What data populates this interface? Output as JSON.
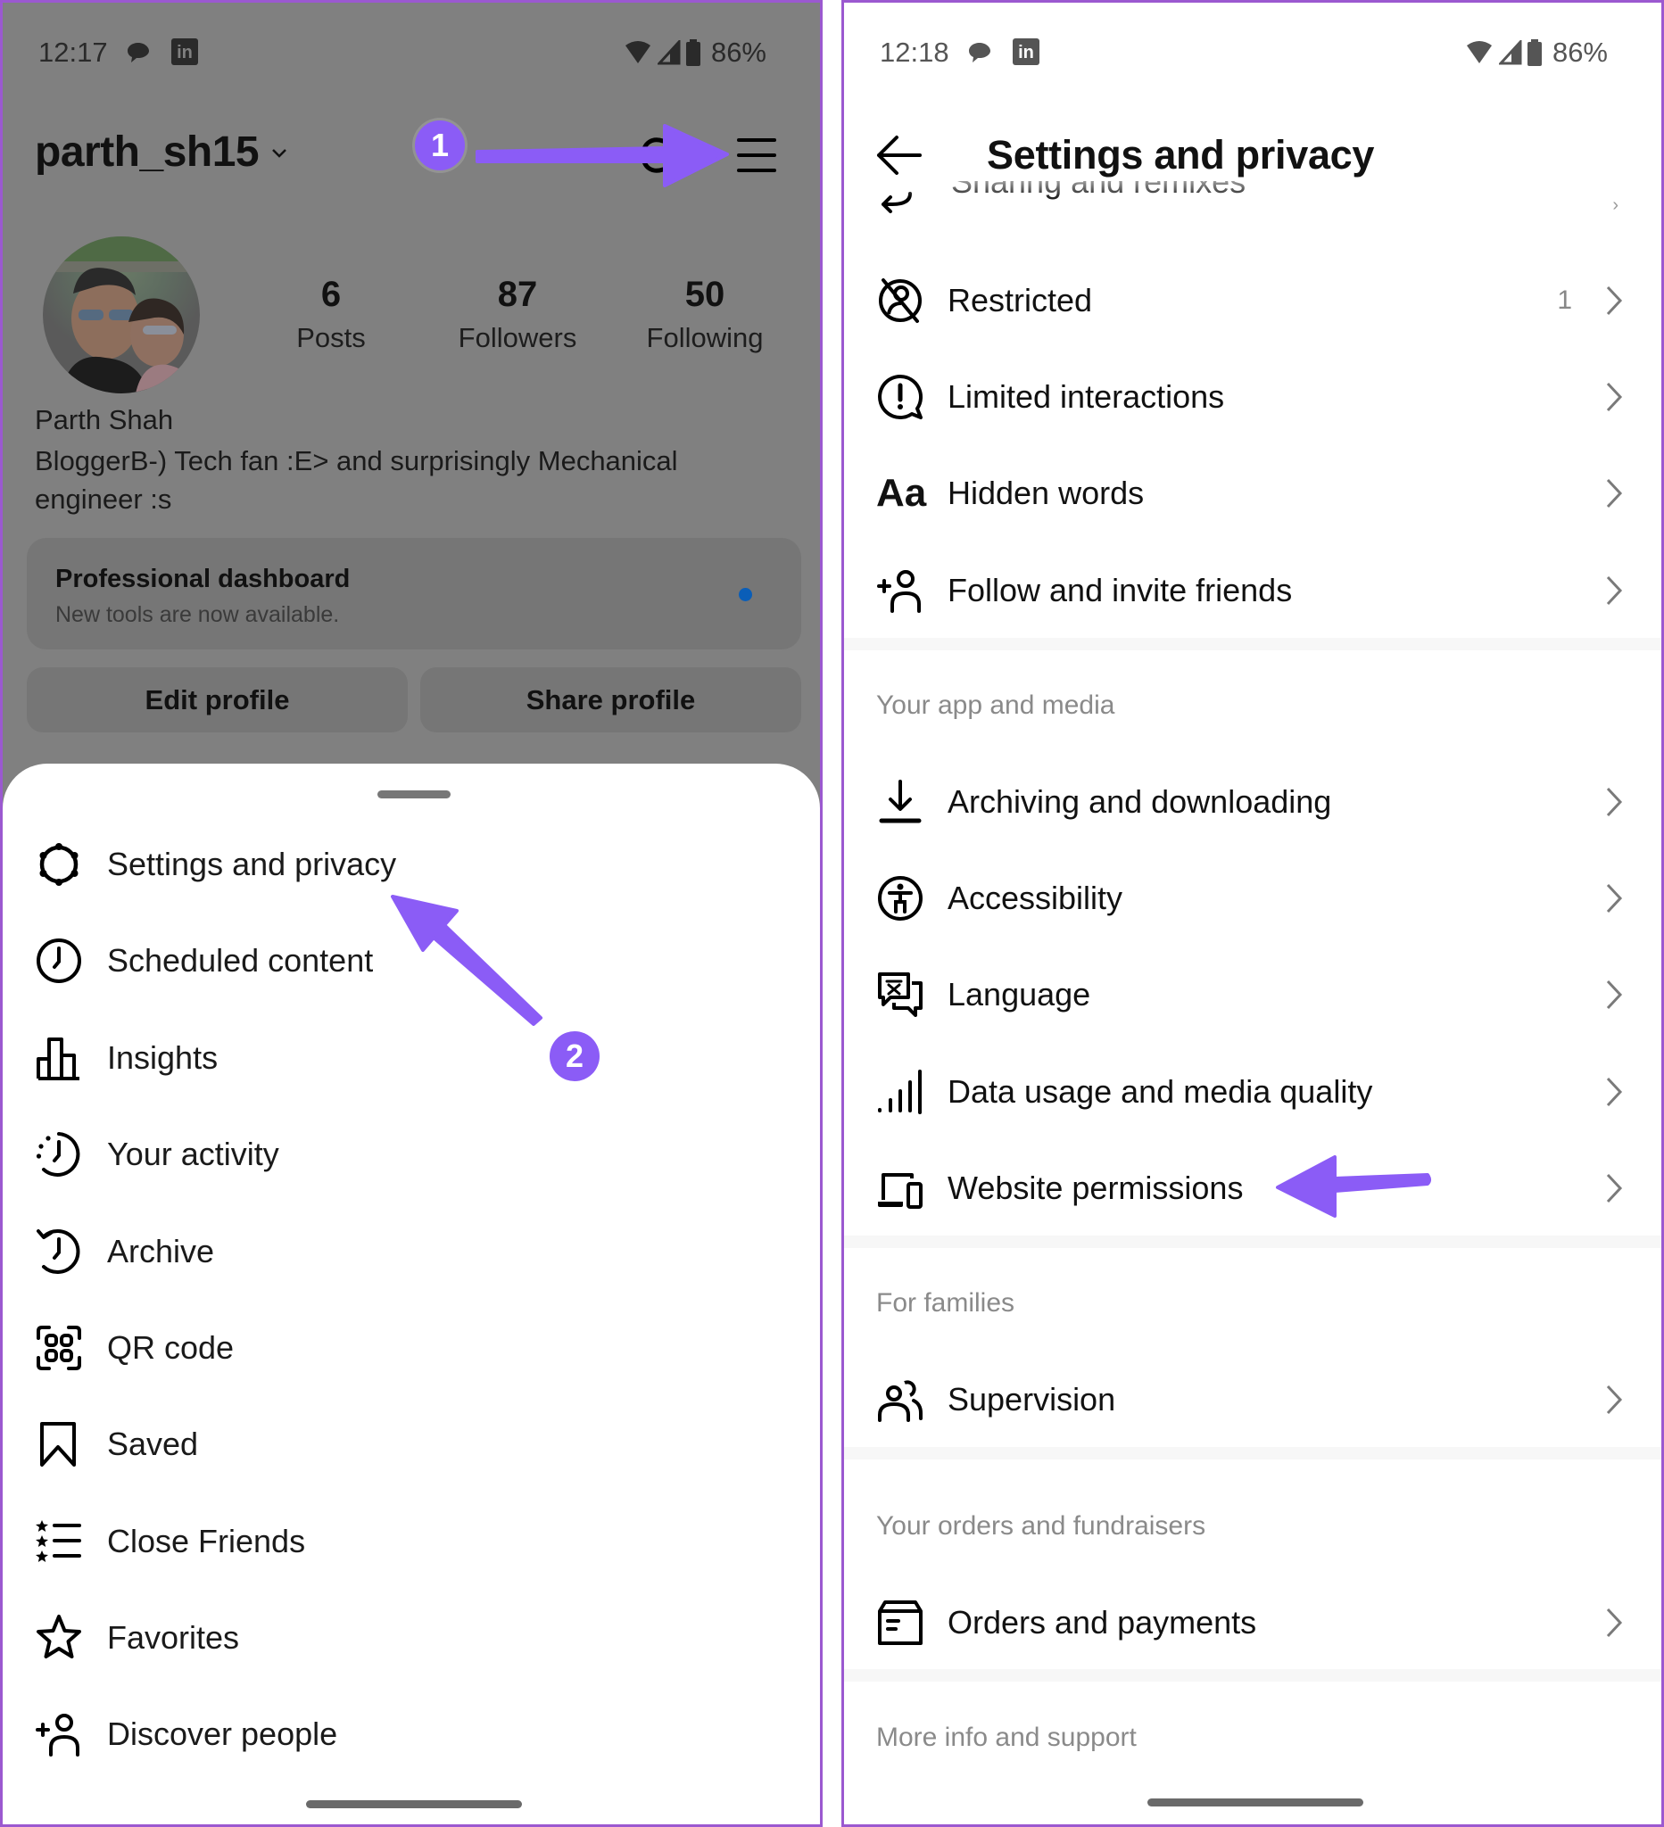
{
  "left_screen": {
    "status_bar": {
      "time": "12:17",
      "battery": "86%",
      "icons": [
        "chat-bubble-icon",
        "linkedin-icon",
        "wifi-icon",
        "signal-icon",
        "battery-icon"
      ]
    },
    "profile": {
      "username": "parth_sh15",
      "stats": [
        {
          "value": "6",
          "label": "Posts"
        },
        {
          "value": "87",
          "label": "Followers"
        },
        {
          "value": "50",
          "label": "Following"
        }
      ],
      "full_name": "Parth Shah",
      "bio": "BloggerB-) Tech fan :E> and surprisingly Mechanical engineer :s",
      "pro_dashboard": {
        "title": "Professional dashboard",
        "subtitle": "New tools are now available.",
        "dot_color": "#0a5eb8"
      },
      "buttons": {
        "edit": "Edit profile",
        "share": "Share profile"
      }
    },
    "menu_sheet": {
      "items": [
        {
          "label": "Settings and privacy",
          "icon": "settings-gear-icon"
        },
        {
          "label": "Scheduled content",
          "icon": "clock-icon"
        },
        {
          "label": "Insights",
          "icon": "bar-chart-icon"
        },
        {
          "label": "Your activity",
          "icon": "activity-icon"
        },
        {
          "label": "Archive",
          "icon": "archive-history-icon"
        },
        {
          "label": "QR code",
          "icon": "qr-code-icon"
        },
        {
          "label": "Saved",
          "icon": "bookmark-icon"
        },
        {
          "label": "Close Friends",
          "icon": "close-friends-list-icon"
        },
        {
          "label": "Favorites",
          "icon": "star-icon"
        },
        {
          "label": "Discover people",
          "icon": "add-person-icon"
        }
      ]
    },
    "annotations": {
      "step1": "1",
      "step2": "2"
    }
  },
  "right_screen": {
    "status_bar": {
      "time": "12:18",
      "battery": "86%"
    },
    "header": {
      "title": "Settings and privacy"
    },
    "partial_item": {
      "label": "Sharing and remixes"
    },
    "groups": [
      {
        "header": "",
        "items": [
          {
            "label": "Restricted",
            "icon": "restricted-icon",
            "badge": "1"
          },
          {
            "label": "Limited interactions",
            "icon": "limited-interactions-icon"
          },
          {
            "label": "Hidden words",
            "icon": "hidden-words-icon",
            "glyph": "Aa"
          },
          {
            "label": "Follow and invite friends",
            "icon": "add-person-icon"
          }
        ]
      },
      {
        "header": "Your app and media",
        "items": [
          {
            "label": "Archiving and downloading",
            "icon": "download-icon"
          },
          {
            "label": "Accessibility",
            "icon": "accessibility-icon"
          },
          {
            "label": "Language",
            "icon": "language-icon"
          },
          {
            "label": "Data usage and media quality",
            "icon": "signal-bars-icon"
          },
          {
            "label": "Website permissions",
            "icon": "devices-icon"
          }
        ]
      },
      {
        "header": "For families",
        "items": [
          {
            "label": "Supervision",
            "icon": "supervision-icon"
          }
        ]
      },
      {
        "header": "Your orders and fundraisers",
        "items": [
          {
            "label": "Orders and payments",
            "icon": "orders-icon"
          }
        ]
      },
      {
        "header": "More info and support",
        "items": []
      }
    ]
  },
  "colors": {
    "annotation": "#8b5cf6",
    "frame": "#9b59d0",
    "overlay": "#808080"
  }
}
